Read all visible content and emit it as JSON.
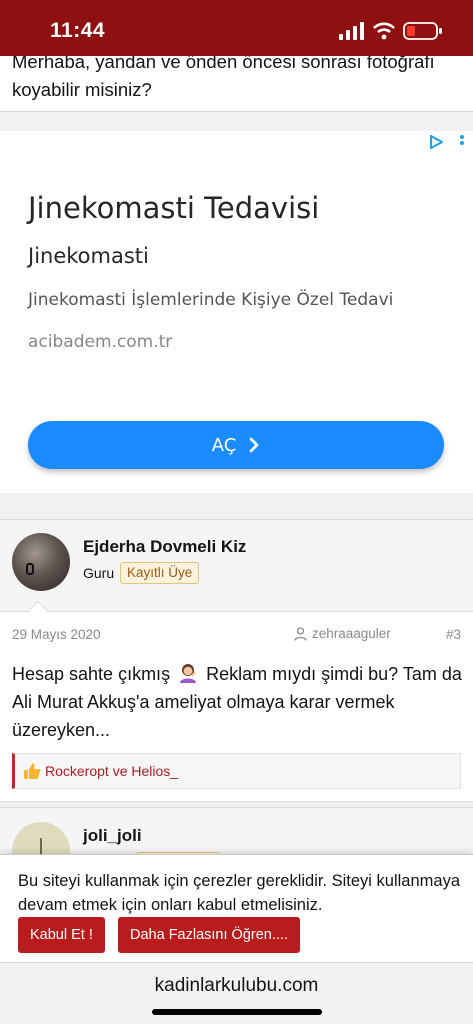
{
  "status_bar": {
    "time": "11:44",
    "icons": [
      "signal-icon",
      "wifi-icon",
      "battery-icon"
    ],
    "background": "#8e1010"
  },
  "previous_post": {
    "text": "Merhaba, yandan ve önden öncesi sonrası fotoğrafı koyabilir misiniz?"
  },
  "ad": {
    "title": "Jinekomasti Tedavisi",
    "subtitle": "Jinekomasti",
    "description": "Jinekomasti İşlemlerinde Kişiye Özel Tedavi",
    "domain": "acibadem.com.tr",
    "button_label": "AÇ",
    "button_color": "#1a8cff",
    "icons": [
      "adchoices-icon",
      "ad-menu-icon",
      "chevron-right-icon"
    ]
  },
  "post": {
    "username": "Ejderha Dovmeli Kiz",
    "user_title": "Guru",
    "badge": "Kayıtlı Üye",
    "date": "29 Mayıs 2020",
    "quoted_user": "zehraaaguler",
    "number": "#3",
    "body_part1": "Hesap sahte çıkmış",
    "body_part2": " Reklam mıydı şimdi bu? Tam da Ali Murat Akkuş'a ameliyat olmaya karar vermek üzereyken...",
    "reactions": "Rockeropt ve Helios_",
    "icons": [
      "user-icon",
      "emoji-person-icon",
      "thumbs-up-icon"
    ]
  },
  "next_post": {
    "username": "joli_joli"
  },
  "cookie_notice": {
    "text": "Bu siteyi kullanmak için çerezler gereklidir. Siteyi kullanmaya devam etmek için onları kabul etmelisiniz.",
    "accept_label": "Kabul Et !",
    "learn_more_label": "Daha Fazlasını Öğren....",
    "button_color": "#b91c1c"
  },
  "browser": {
    "url": "kadinlarkulubu.com"
  }
}
